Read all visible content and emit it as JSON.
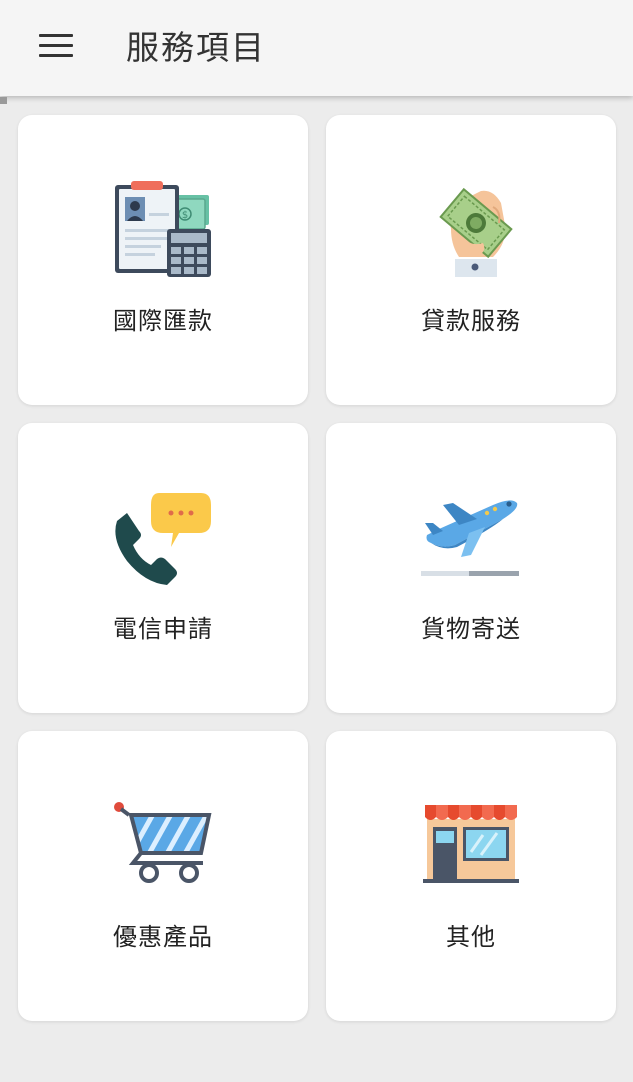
{
  "header": {
    "title": "服務項目"
  },
  "services": [
    {
      "label": "國際匯款",
      "icon": "remittance-document-calculator-icon"
    },
    {
      "label": "貸款服務",
      "icon": "hand-holding-cash-icon"
    },
    {
      "label": "電信申請",
      "icon": "phone-chat-bubble-icon"
    },
    {
      "label": "貨物寄送",
      "icon": "airplane-takeoff-icon"
    },
    {
      "label": "優惠產品",
      "icon": "shopping-cart-icon"
    },
    {
      "label": "其他",
      "icon": "storefront-icon"
    }
  ],
  "colors": {
    "appbar": "#f5f5f5",
    "background": "#ececec",
    "card": "#ffffff",
    "text": "#222222"
  }
}
